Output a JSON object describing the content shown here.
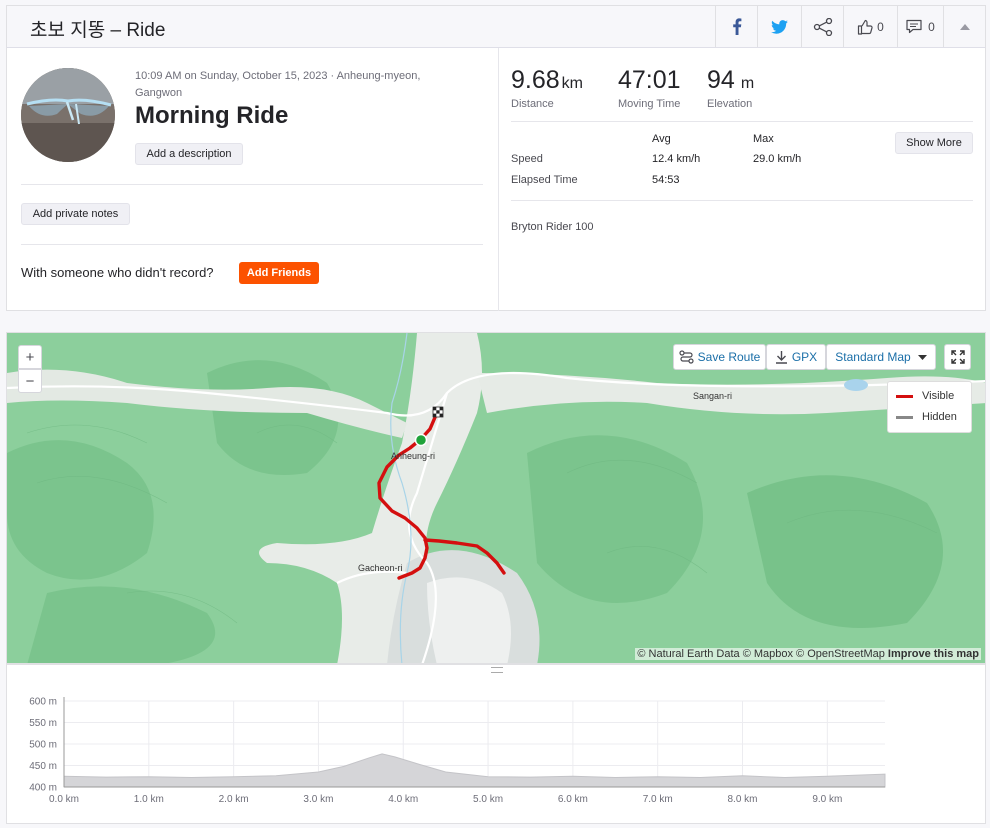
{
  "header": {
    "title": "초보 지똥 – Ride",
    "kudos_count": "0",
    "comment_count": "0",
    "icons": [
      "facebook-icon",
      "twitter-icon",
      "share-icon",
      "thumbs-up-icon",
      "comment-icon",
      "chevron-up-icon"
    ]
  },
  "activity": {
    "date_location": "10:09 AM on Sunday, October 15, 2023 · Anheung-myeon, Gangwon",
    "title": "Morning Ride",
    "add_description": "Add a description",
    "add_private_notes": "Add private notes",
    "with_someone": "With someone who didn't record?",
    "add_friends": "Add Friends"
  },
  "stats": {
    "distance_value": "9.68",
    "distance_unit": "km",
    "distance_label": "Distance",
    "moving_time_value": "47:01",
    "moving_time_label": "Moving Time",
    "elevation_value": "94",
    "elevation_unit": "m",
    "elevation_label": "Elevation",
    "avg_header": "Avg",
    "max_header": "Max",
    "speed_label": "Speed",
    "speed_avg": "12.4 km/h",
    "speed_max": "29.0 km/h",
    "elapsed_label": "Elapsed Time",
    "elapsed_value": "54:53",
    "show_more": "Show More",
    "device": "Bryton Rider 100"
  },
  "map": {
    "zoom_in": "+",
    "zoom_out": "−",
    "save_route": "Save Route",
    "gpx": "GPX",
    "map_style": "Standard Map",
    "legend_visible": "Visible",
    "legend_hidden": "Hidden",
    "place_labels": [
      "Sangan-ri",
      "Anheung-ri",
      "Gacheon-ri"
    ],
    "attribution": "© Natural Earth Data © Mapbox © OpenStreetMap",
    "improve": "Improve this map",
    "route_color": "#d40f0f",
    "hidden_color": "#888888"
  },
  "elevation_chart": {
    "y_ticks": [
      "600 m",
      "550 m",
      "500 m",
      "450 m",
      "400 m"
    ],
    "x_ticks": [
      "0.0 km",
      "1.0 km",
      "2.0 km",
      "3.0 km",
      "4.0 km",
      "5.0 km",
      "6.0 km",
      "7.0 km",
      "8.0 km",
      "9.0 km"
    ]
  },
  "chart_data": {
    "type": "area",
    "xlabel": "",
    "ylabel": "",
    "ylim": [
      400,
      600
    ],
    "xlim": [
      0,
      9.68
    ],
    "x": [
      0,
      0.5,
      1,
      1.5,
      2,
      2.5,
      3,
      3.3,
      3.6,
      3.75,
      3.9,
      4.2,
      4.5,
      5,
      5.5,
      6,
      6.5,
      7,
      7.5,
      8,
      8.5,
      9,
      9.68
    ],
    "values": [
      425,
      423,
      424,
      422,
      424,
      426,
      435,
      448,
      468,
      477,
      470,
      452,
      435,
      424,
      423,
      425,
      422,
      424,
      422,
      426,
      422,
      425,
      430
    ]
  }
}
